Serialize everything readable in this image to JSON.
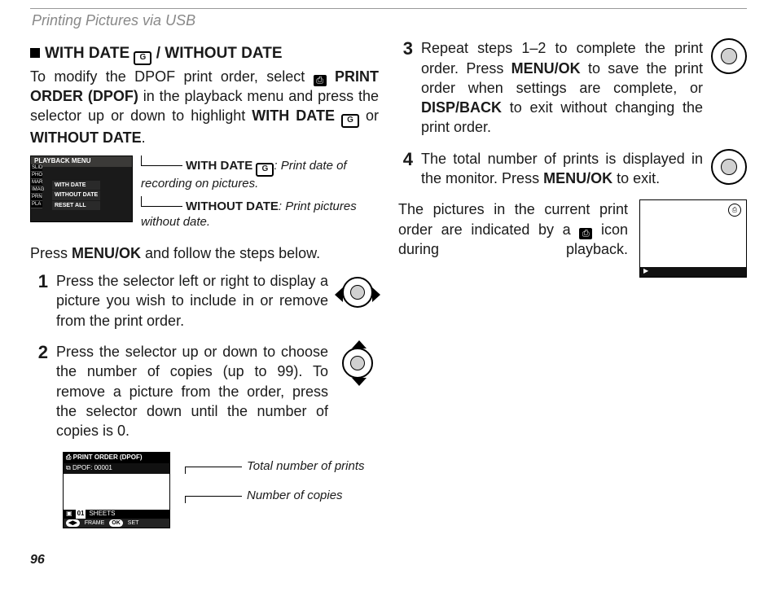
{
  "running_head": "Printing Pictures via USB",
  "page_number": "96",
  "heading_line": "WITH DATE / WITHOUT DATE",
  "intro": {
    "seg1": "To modify the DPOF print order, select ",
    "seg2_bold": "PRINT ORDER (DPOF)",
    "seg3": " in the playback menu and press the selector up or down to highlight ",
    "seg4_bold": "WITH DATE ",
    "seg5": " or ",
    "seg6_bold": "WITHOUT DATE",
    "seg7": "."
  },
  "fig1": {
    "lcd_title": "PLAYBACK MENU",
    "side": [
      "SLID",
      "PHO",
      "MAR",
      "IMAG",
      "PRN",
      "PLA"
    ],
    "opts": [
      "WITH DATE",
      "WITHOUT DATE",
      "RESET ALL"
    ],
    "callout_withdate_label": "WITH DATE ",
    "callout_withdate_body": ": Print date of recording on pictures.",
    "callout_withoutdate_label": "WITHOUT DATE",
    "callout_withoutdate_body": ": Print pictures without date."
  },
  "after_fig1": {
    "seg1": "Press ",
    "seg2_bold": "MENU/OK",
    "seg3": " and follow the steps below."
  },
  "steps_left": {
    "s1": "Press the selector left or right to display a picture you wish to include in or remove from the print order.",
    "s2": "Press the selector up or down to choose the number of copies (up to 99).  To remove a picture from the order, press the selector down until the number of copies is 0."
  },
  "fig2": {
    "bar_top": "PRINT ORDER (DPOF)",
    "bar_sub": "DPOF: 00001",
    "sheets_num": "01",
    "sheets_label": "SHEETS",
    "foot_frame": "FRAME",
    "foot_set": "SET",
    "callout_total": "Total number of prints",
    "callout_copies": "Number of copies"
  },
  "steps_right": {
    "s3": {
      "a": "Repeat steps 1–2 to complete the print order.  Press ",
      "b_bold": "MENU/OK",
      "c": " to save the print order when settings are complete, or ",
      "d_bold": "DISP/BACK",
      "e": " to exit without changing the print order."
    },
    "s4": {
      "a": "The total number of prints is displayed in the monitor.  Press ",
      "b_bold": "MENU/OK",
      "c": " to exit."
    }
  },
  "playback_note": {
    "a": "The pictures in the current print order are indicated by a ",
    "b": " icon during playback."
  }
}
